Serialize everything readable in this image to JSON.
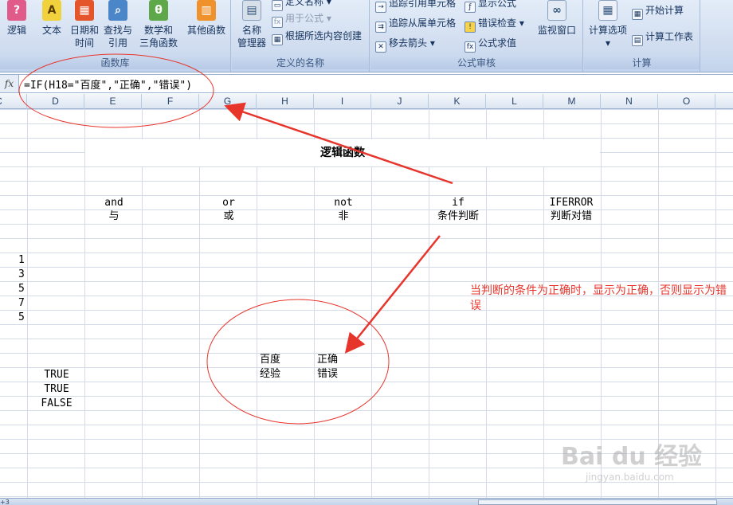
{
  "ribbon": {
    "function_library": {
      "label": "函数库",
      "buttons": [
        {
          "label1": "逻辑",
          "label2": "",
          "icon": "question-book-icon"
        },
        {
          "label1": "文本",
          "label2": "",
          "icon": "letter-book-icon"
        },
        {
          "label1": "日期和",
          "label2": "时间",
          "icon": "calendar-book-icon"
        },
        {
          "label1": "查找与",
          "label2": "引用",
          "icon": "search-book-icon"
        },
        {
          "label1": "数学和",
          "label2": "三角函数",
          "icon": "theta-book-icon"
        },
        {
          "label1": "其他函数",
          "label2": "",
          "icon": "books-icon"
        }
      ]
    },
    "defined_names": {
      "label": "定义的名称",
      "name_manager_1": "名称",
      "name_manager_2": "管理器",
      "define_name": "定义名称",
      "use_in_formula": "用于公式",
      "create_from_selection": "根据所选内容创建"
    },
    "formula_auditing": {
      "label": "公式审核",
      "trace_precedents": "追踪引用单元格",
      "trace_dependents": "追踪从属单元格",
      "remove_arrows": "移去箭头",
      "show_formulas": "显示公式",
      "error_checking": "错误检查",
      "evaluate_formula": "公式求值",
      "watch_window": "监视窗口"
    },
    "calculation": {
      "label": "计算",
      "calc_options": "计算选项",
      "calc_now": "开始计算",
      "calc_sheet": "计算工作表"
    }
  },
  "formula_bar": {
    "fx": "fx",
    "formula": "=IF(H18=\"百度\",\"正确\",\"错误\")"
  },
  "columns": [
    "C",
    "D",
    "E",
    "F",
    "G",
    "H",
    "I",
    "J",
    "K",
    "L",
    "M",
    "N",
    "O"
  ],
  "sheet": {
    "title": "逻辑函数",
    "functions": [
      {
        "name": "and",
        "desc": "与"
      },
      {
        "name": "or",
        "desc": "或"
      },
      {
        "name": "not",
        "desc": "非"
      },
      {
        "name": "if",
        "desc": "条件判断"
      },
      {
        "name": "IFERROR",
        "desc": "判断对错"
      }
    ],
    "numbers": [
      "1",
      "3",
      "5",
      "7",
      "5"
    ],
    "booleans": [
      "TRUE",
      "TRUE",
      "FALSE"
    ],
    "h_values": [
      "百度",
      "经验"
    ],
    "i_values": [
      "正确",
      "错误"
    ]
  },
  "annotation": "当判断的条件为正确时，显示为正确，否则显示为错误",
  "watermark": {
    "main": "Bai du 经验",
    "sub": "jingyan.baidu.com"
  },
  "sheet_tab": "+3",
  "colors": {
    "annotation": "#e8352c",
    "arrow": "#e8352c"
  }
}
